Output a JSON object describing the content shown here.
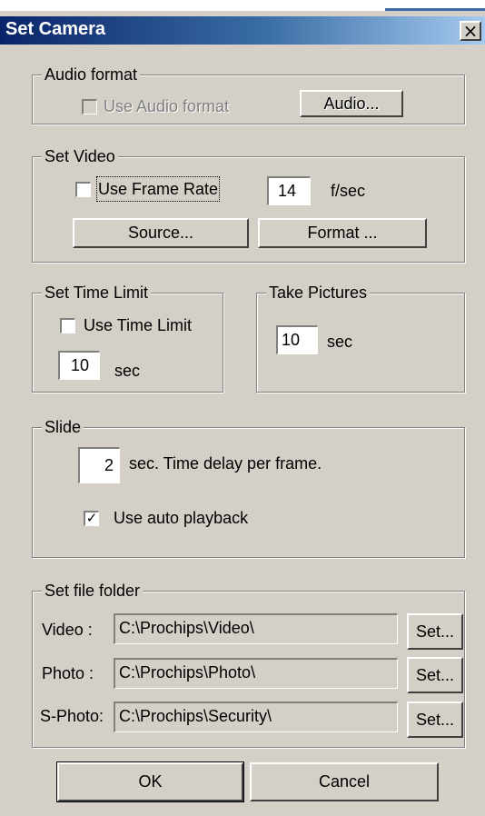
{
  "window": {
    "title": "Set Camera",
    "close_glyph": "×"
  },
  "audio": {
    "legend": "Audio format",
    "use_label": "Use Audio format",
    "button": "Audio..."
  },
  "video": {
    "legend": "Set Video",
    "use_label": "Use Frame Rate",
    "frame_rate": "14",
    "unit": "f/sec",
    "source_button": "Source...",
    "format_button": "Format ..."
  },
  "time_limit": {
    "legend": "Set Time Limit",
    "use_label": "Use Time Limit",
    "value": "10",
    "unit": "sec"
  },
  "take_pictures": {
    "legend": "Take Pictures",
    "value": "10",
    "unit": "sec"
  },
  "slide": {
    "legend": "Slide",
    "value": "2",
    "unit_desc": "sec.  Time delay per frame.",
    "autoplay_label": "Use auto playback",
    "autoplay_check": "✓"
  },
  "folders": {
    "legend": "Set file folder",
    "rows": [
      {
        "label": "Video :",
        "path": "C:\\Prochips\\Video\\",
        "button": "Set..."
      },
      {
        "label": "Photo :",
        "path": "C:\\Prochips\\Photo\\",
        "button": "Set..."
      },
      {
        "label": "S-Photo:",
        "path": "C:\\Prochips\\Security\\",
        "button": "Set..."
      }
    ]
  },
  "footer": {
    "ok": "OK",
    "cancel": "Cancel"
  }
}
